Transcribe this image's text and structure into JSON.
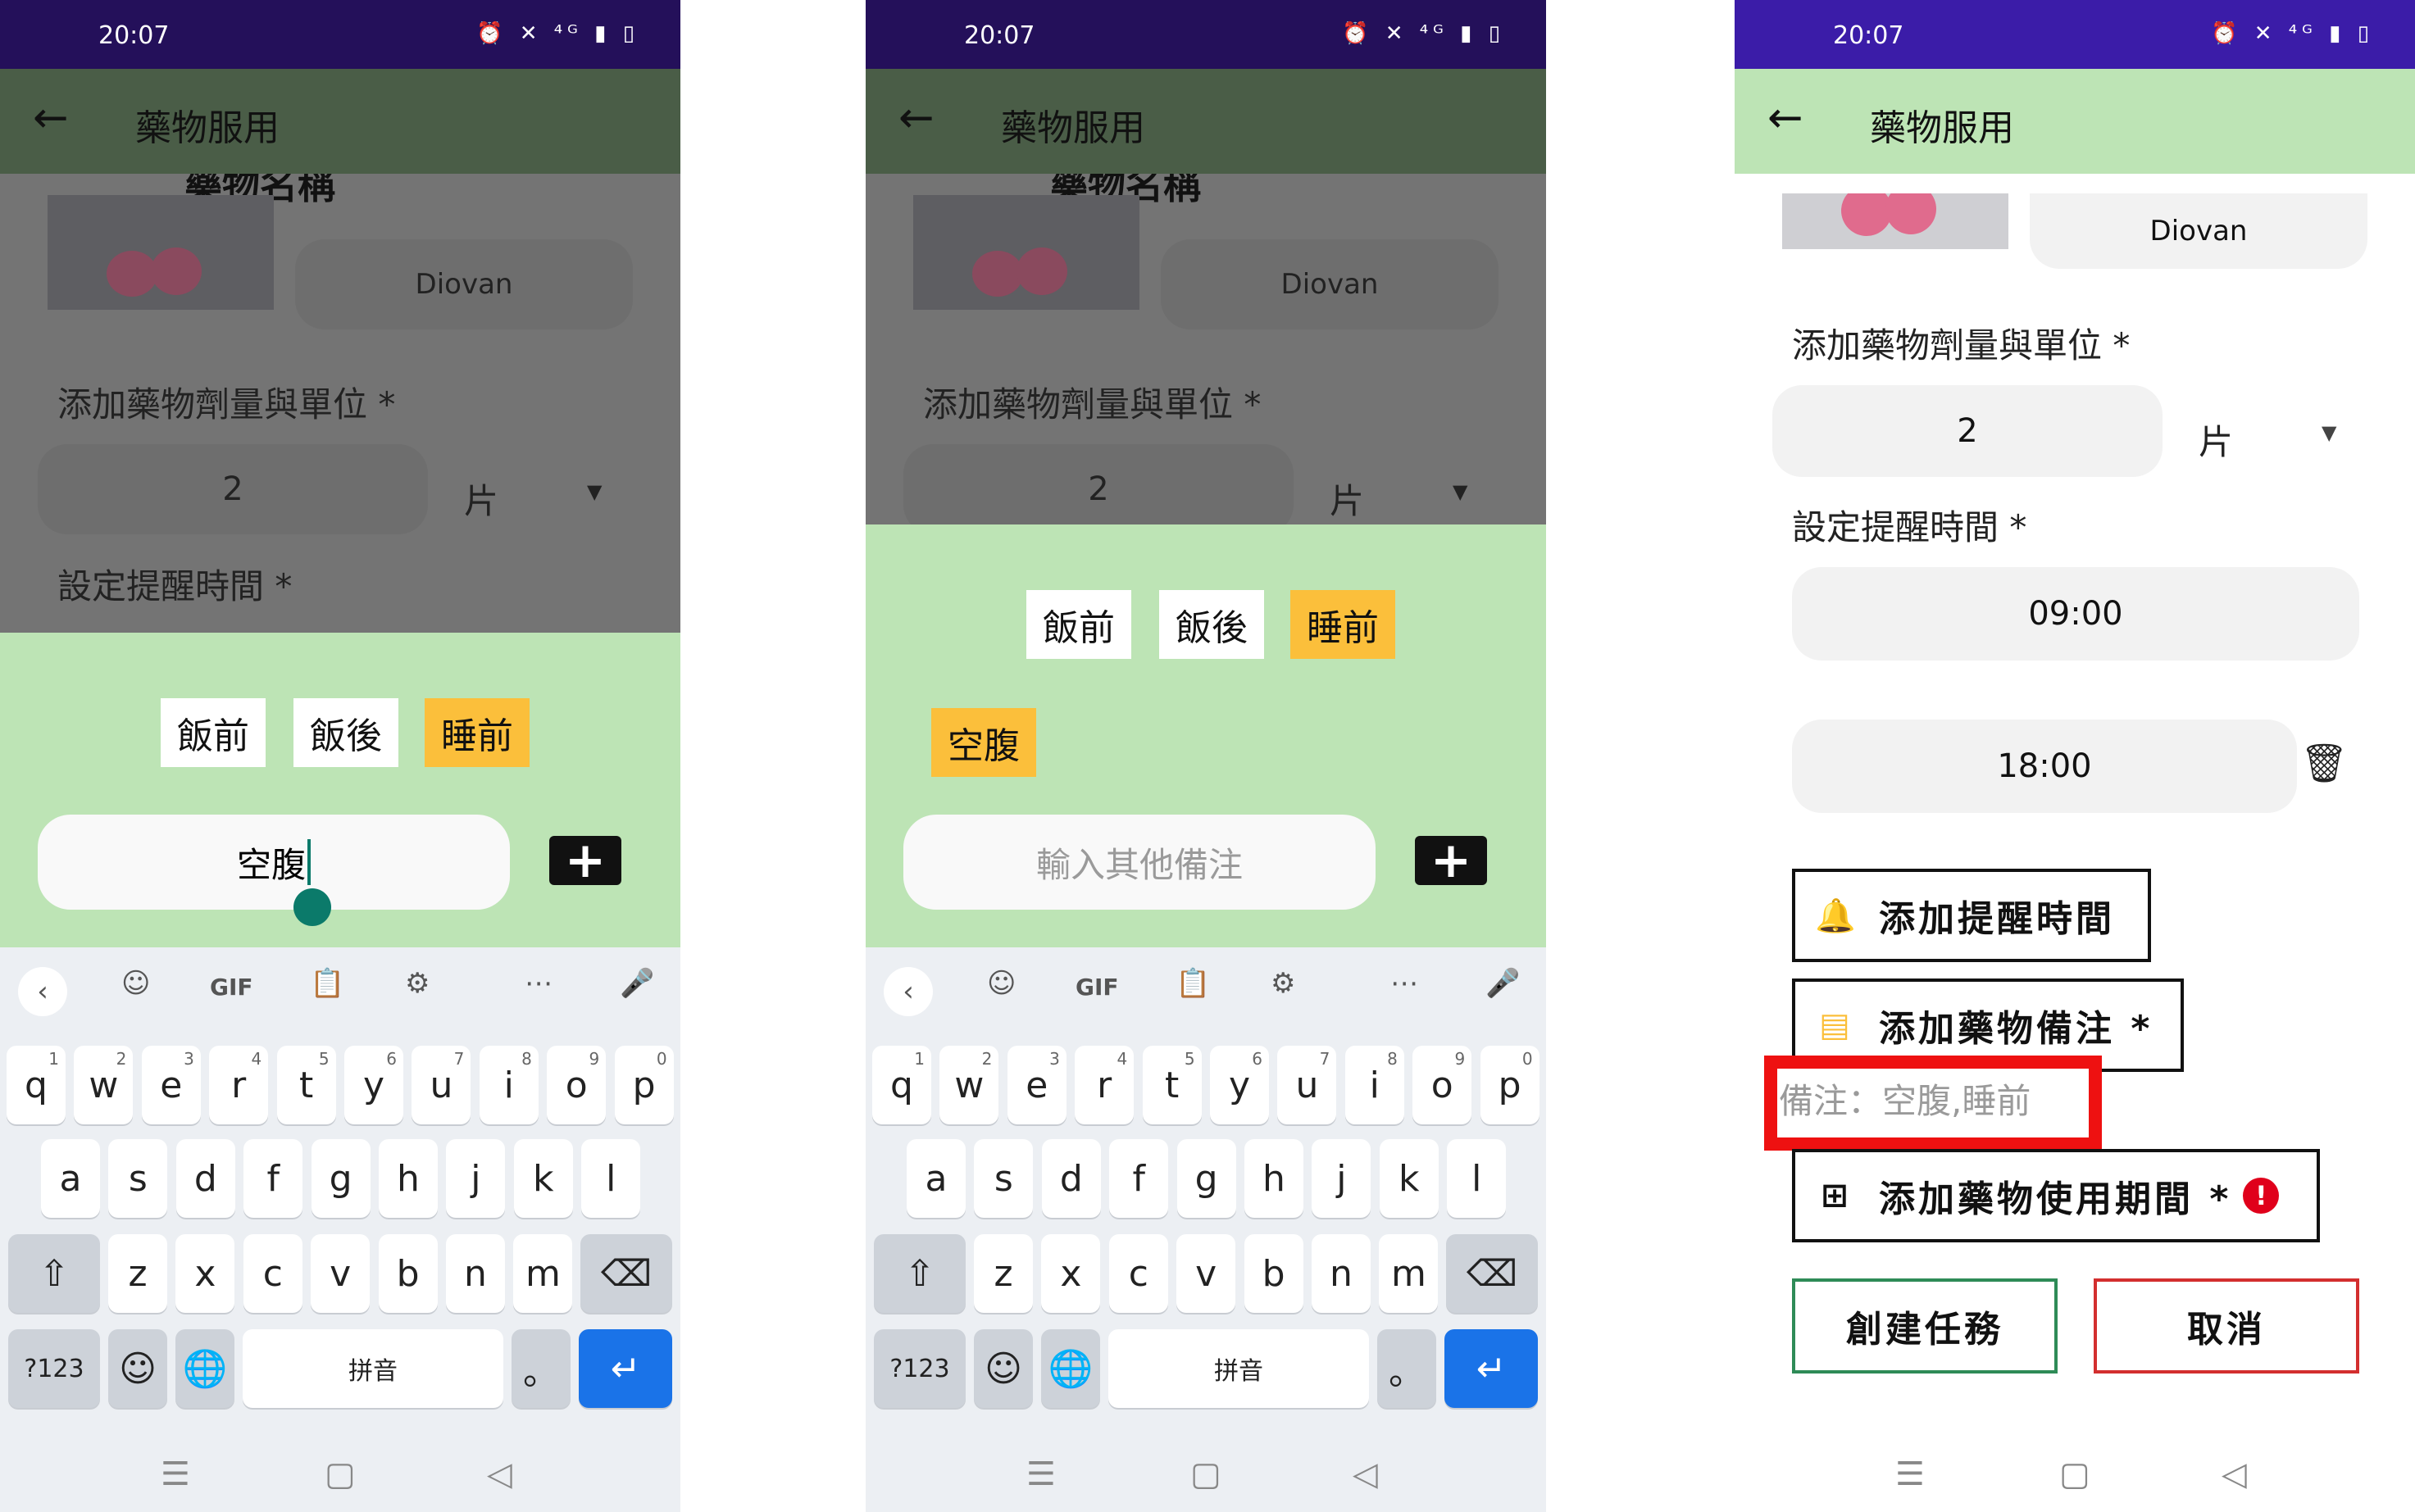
{
  "status": {
    "time": "20:07",
    "icons_text": "⏰ ✕ ⁴ᴳ ▮ ▯"
  },
  "app": {
    "title": "藥物服用",
    "back_icon": "←"
  },
  "drug": {
    "name": "Diovan",
    "cut_title": "藥物名稱"
  },
  "dose": {
    "label": "添加藥物劑量與單位 *",
    "value": "2",
    "unit": "片",
    "dropdown_icon": "▼"
  },
  "reminder": {
    "label": "設定提醒時間 *",
    "times": [
      "09:00",
      "18:00"
    ],
    "delete_icon": "🗑"
  },
  "chips": {
    "before_meal": "飯前",
    "after_meal": "飯後",
    "bedtime": "睡前",
    "empty_stomach": "空腹"
  },
  "note_input": {
    "typed": "空腹",
    "placeholder": "輸入其他備注"
  },
  "plus_symbol": "+",
  "keyboard": {
    "toolbar": [
      "‹",
      "☺",
      "GIF",
      "📋",
      "⚙",
      "⋯",
      "🎤"
    ],
    "row1": [
      "q",
      "w",
      "e",
      "r",
      "t",
      "y",
      "u",
      "i",
      "o",
      "p"
    ],
    "row1_hints": [
      "1",
      "2",
      "3",
      "4",
      "5",
      "6",
      "7",
      "8",
      "9",
      "0"
    ],
    "row2": [
      "a",
      "s",
      "d",
      "f",
      "g",
      "h",
      "j",
      "k",
      "l"
    ],
    "row3": [
      "z",
      "x",
      "c",
      "v",
      "b",
      "n",
      "m"
    ],
    "shift_icon": "⇧",
    "backspace_icon": "⌫",
    "mode": "?123",
    "emoji": "☺",
    "emoji_sub": ",",
    "globe": "🌐",
    "space": "拼音",
    "period": "。",
    "enter_icon": "↵"
  },
  "navbar": {
    "menu": "☰",
    "home": "▢",
    "back": "◁"
  },
  "buttons": {
    "add_reminder": "添加提醒時間",
    "add_note": "添加藥物備注 *",
    "add_period": "添加藥物使用期間 *",
    "create": "創建任務",
    "cancel": "取消"
  },
  "note_display": "備注：空腹,睡前",
  "icons": {
    "bell": "bell-plus-icon",
    "note": "note-icon",
    "plus": "plus-box-icon",
    "alert": "!"
  },
  "colors": {
    "status": "#24105a",
    "appbar_dim": "#4a5d47",
    "appbar": "#bde4b5",
    "orange": "#fbbf3b",
    "green_border": "#2e8b57",
    "red_border": "#d32f2f",
    "highlight": "#ee1111"
  }
}
